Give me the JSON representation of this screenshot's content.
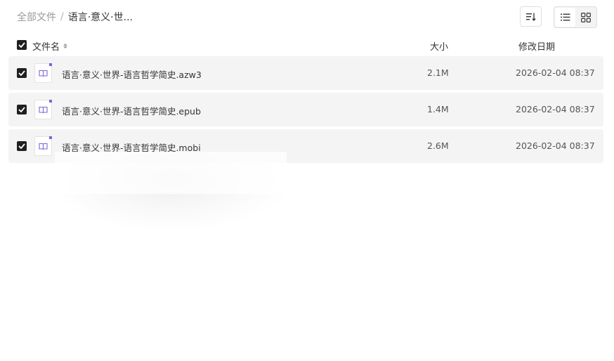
{
  "breadcrumb": {
    "root": "全部文件",
    "separator": "/",
    "current": "语言·意义·世..."
  },
  "toolbar": {
    "sort_icon": "sort-icon",
    "view_list_icon": "list-view-icon",
    "view_grid_icon": "grid-view-icon",
    "active_view": "list"
  },
  "table": {
    "headers": {
      "name": "文件名",
      "size": "大小",
      "date": "修改日期"
    },
    "rows": [
      {
        "name": "语言·意义·世界-语言哲学简史.azw3",
        "size": "2.1M",
        "date": "2026-02-04 08:37",
        "checked": true,
        "icon": "ebook-icon"
      },
      {
        "name": "语言·意义·世界-语言哲学简史.epub",
        "size": "1.4M",
        "date": "2026-02-04 08:37",
        "checked": true,
        "icon": "ebook-icon"
      },
      {
        "name": "语言·意义·世界-语言哲学简史.mobi",
        "size": "2.6M",
        "date": "2026-02-04 08:37",
        "checked": true,
        "icon": "ebook-icon"
      }
    ]
  },
  "colors": {
    "accent": "#7f63d6",
    "checkbox": "#1f1f1f",
    "row_bg": "#f4f4f4"
  }
}
